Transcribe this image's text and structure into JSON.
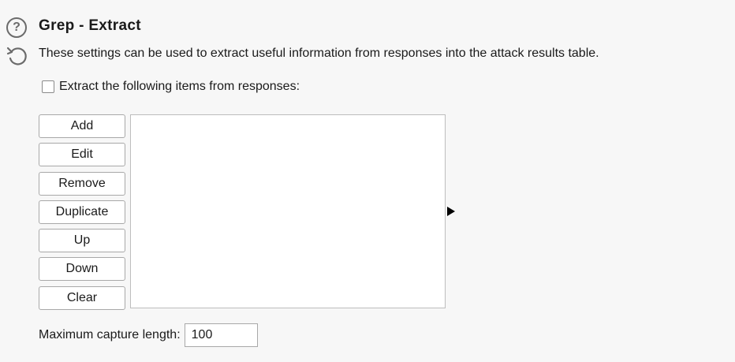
{
  "section": {
    "title": "Grep - Extract",
    "description": "These settings can be used to extract useful information from responses into the attack results table.",
    "help_icon": "help-icon",
    "reset_icon": "reset-icon",
    "help_glyph": "?"
  },
  "extract": {
    "checkbox_label": "Extract the following items from responses:",
    "checked": false
  },
  "buttons": {
    "add": "Add",
    "edit": "Edit",
    "remove": "Remove",
    "duplicate": "Duplicate",
    "up": "Up",
    "down": "Down",
    "clear": "Clear"
  },
  "items_list": [],
  "max_capture": {
    "label": "Maximum capture length:",
    "value": "100"
  }
}
